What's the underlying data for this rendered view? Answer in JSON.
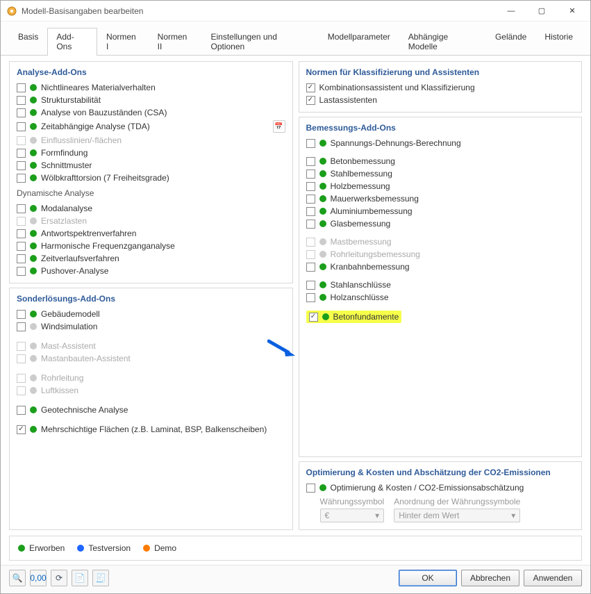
{
  "title": "Modell-Basisangaben bearbeiten",
  "tabs": [
    "Basis",
    "Add-Ons",
    "Normen I",
    "Normen II",
    "Einstellungen und Optionen",
    "Modellparameter",
    "Abhängige Modelle",
    "Gelände",
    "Historie"
  ],
  "activeTab": 1,
  "left": {
    "analysis": {
      "title": "Analyse-Add-Ons",
      "items": [
        {
          "label": "Nichtlineares Materialverhalten",
          "checked": false,
          "status": "green",
          "enabled": true
        },
        {
          "label": "Strukturstabilität",
          "checked": false,
          "status": "green",
          "enabled": true
        },
        {
          "label": "Analyse von Bauzuständen (CSA)",
          "checked": false,
          "status": "green",
          "enabled": true
        },
        {
          "label": "Zeitabhängige Analyse (TDA)",
          "checked": false,
          "status": "green",
          "enabled": true,
          "hasBtn": true
        },
        {
          "label": "Einflusslinien/-flächen",
          "checked": false,
          "status": "grey",
          "enabled": false
        },
        {
          "label": "Formfindung",
          "checked": false,
          "status": "green",
          "enabled": true
        },
        {
          "label": "Schnittmuster",
          "checked": false,
          "status": "green",
          "enabled": true
        },
        {
          "label": "Wölbkrafttorsion (7 Freiheitsgrade)",
          "checked": false,
          "status": "green",
          "enabled": true
        }
      ],
      "dynTitle": "Dynamische Analyse",
      "dynItems": [
        {
          "label": "Modalanalyse",
          "checked": false,
          "status": "green",
          "enabled": true
        },
        {
          "label": "Ersatzlasten",
          "checked": false,
          "status": "grey",
          "enabled": false
        },
        {
          "label": "Antwortspektrenverfahren",
          "checked": false,
          "status": "green",
          "enabled": true
        },
        {
          "label": "Harmonische Frequenzganganalyse",
          "checked": false,
          "status": "green",
          "enabled": true
        },
        {
          "label": "Zeitverlaufsverfahren",
          "checked": false,
          "status": "green",
          "enabled": true
        },
        {
          "label": "Pushover-Analyse",
          "checked": false,
          "status": "green",
          "enabled": true
        }
      ]
    },
    "special": {
      "title": "Sonderlösungs-Add-Ons",
      "items": [
        {
          "label": "Gebäudemodell",
          "checked": false,
          "status": "green",
          "enabled": true
        },
        {
          "label": "Windsimulation",
          "checked": false,
          "status": "grey",
          "enabled": true
        }
      ],
      "items2": [
        {
          "label": "Mast-Assistent",
          "checked": false,
          "status": "grey",
          "enabled": false
        },
        {
          "label": "Mastanbauten-Assistent",
          "checked": false,
          "status": "grey",
          "enabled": false
        }
      ],
      "items3": [
        {
          "label": "Rohrleitung",
          "checked": false,
          "status": "grey",
          "enabled": false
        },
        {
          "label": "Luftkissen",
          "checked": false,
          "status": "grey",
          "enabled": false
        }
      ],
      "items4": [
        {
          "label": "Geotechnische Analyse",
          "checked": false,
          "status": "green",
          "enabled": true
        }
      ],
      "items5": [
        {
          "label": "Mehrschichtige Flächen (z.B. Laminat, BSP, Balkenscheiben)",
          "checked": true,
          "status": "green",
          "enabled": true
        }
      ]
    }
  },
  "right": {
    "norms": {
      "title": "Normen für Klassifizierung und Assistenten",
      "items": [
        {
          "label": "Kombinationsassistent und Klassifizierung",
          "checked": true
        },
        {
          "label": "Lastassistenten",
          "checked": true
        }
      ]
    },
    "design": {
      "title": "Bemessungs-Add-Ons",
      "g1": [
        {
          "label": "Spannungs-Dehnungs-Berechnung",
          "checked": false,
          "status": "green",
          "enabled": true
        }
      ],
      "g2": [
        {
          "label": "Betonbemessung",
          "checked": false,
          "status": "green",
          "enabled": true
        },
        {
          "label": "Stahlbemessung",
          "checked": false,
          "status": "green",
          "enabled": true
        },
        {
          "label": "Holzbemessung",
          "checked": false,
          "status": "green",
          "enabled": true
        },
        {
          "label": "Mauerwerksbemessung",
          "checked": false,
          "status": "green",
          "enabled": true
        },
        {
          "label": "Aluminiumbemessung",
          "checked": false,
          "status": "green",
          "enabled": true
        },
        {
          "label": "Glasbemessung",
          "checked": false,
          "status": "green",
          "enabled": true
        }
      ],
      "g3": [
        {
          "label": "Mastbemessung",
          "checked": false,
          "status": "grey",
          "enabled": false
        },
        {
          "label": "Rohrleitungsbemessung",
          "checked": false,
          "status": "grey",
          "enabled": false
        },
        {
          "label": "Kranbahnbemessung",
          "checked": false,
          "status": "green",
          "enabled": true
        }
      ],
      "g4": [
        {
          "label": "Stahlanschlüsse",
          "checked": false,
          "status": "green",
          "enabled": true
        },
        {
          "label": "Holzanschlüsse",
          "checked": false,
          "status": "green",
          "enabled": true
        }
      ],
      "g5": [
        {
          "label": "Betonfundamente",
          "checked": true,
          "status": "green",
          "enabled": true,
          "highlight": true
        }
      ]
    },
    "opt": {
      "title": "Optimierung & Kosten und Abschätzung der CO2-Emissionen",
      "item": {
        "label": "Optimierung & Kosten / CO2-Emissionsabschätzung",
        "checked": false,
        "status": "green",
        "enabled": true
      },
      "currencyLabel": "Währungssymbol",
      "currencyValue": "€",
      "orderLabel": "Anordnung der Währungssymbole",
      "orderValue": "Hinter dem Wert"
    }
  },
  "legend": {
    "green": "Erworben",
    "blue": "Testversion",
    "orange": "Demo"
  },
  "buttons": {
    "ok": "OK",
    "cancel": "Abbrechen",
    "apply": "Anwenden"
  }
}
